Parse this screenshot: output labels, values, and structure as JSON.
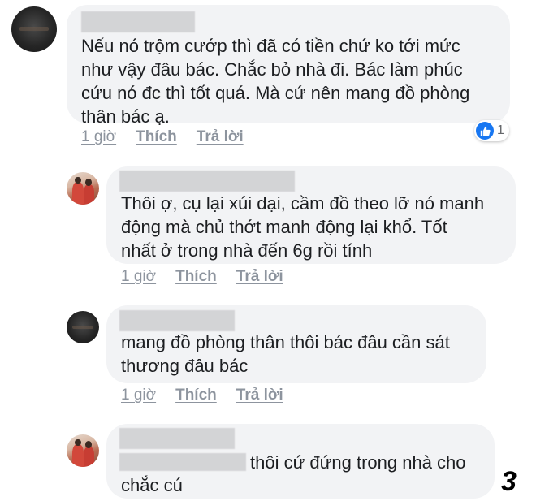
{
  "comments": [
    {
      "text": "Nếu nó trộm cướp thì đã có tiền chứ ko tới mức\nnhư vậy đâu bác. Chắc bỏ nhà đi. Bác làm phúc\ncứu nó đc thì tốt quá. Mà cứ nên mang đồ phòng\nthân bác ạ.",
      "time": "1 giờ",
      "like": "Thích",
      "reply": "Trả lời",
      "reaction_count": "1",
      "reaction_icon": "thumbs-up-icon"
    },
    {
      "text": "Thôi ợ, cụ lại xúi dại, cầm đồ theo lỡ nó manh\nđộng mà chủ thớt manh động lại khổ. Tốt\nnhất ở trong nhà đến 6g rồi tính",
      "time": "1 giờ",
      "like": "Thích",
      "reply": "Trả lời"
    },
    {
      "text": "mang đồ phòng thân thôi bác đâu cần sát\nthương đâu bác",
      "time": "1 giờ",
      "like": "Thích",
      "reply": "Trả lời"
    },
    {
      "text_line1": "thôi cứ đứng trong nhà cho",
      "text_line2": "chắc cú"
    }
  ],
  "page_number": "3",
  "colors": {
    "bubble": "#f2f3f5",
    "text": "#1c1e21",
    "meta": "#8d949e",
    "like_blue": "#1877f2",
    "redaction": "#d3d4d6"
  }
}
